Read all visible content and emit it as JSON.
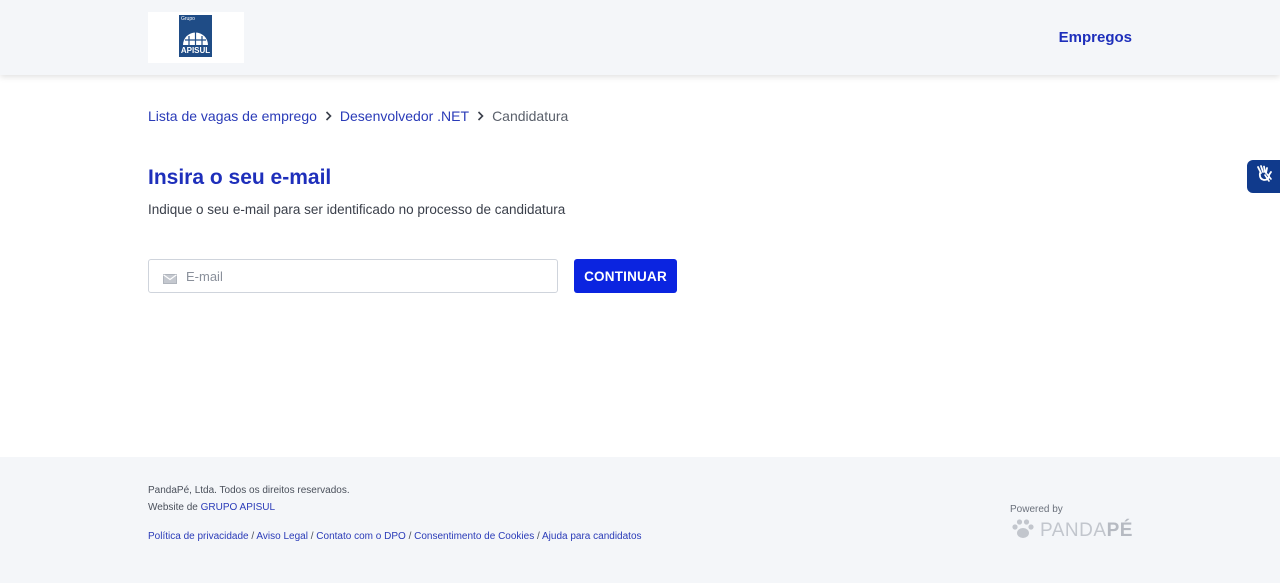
{
  "header": {
    "logo": {
      "small_text": "Grupo",
      "text": "APISUL"
    },
    "nav": {
      "empregos": "Empregos"
    }
  },
  "breadcrumb": {
    "items": [
      {
        "label": "Lista de vagas de emprego"
      },
      {
        "label": "Desenvolvedor .NET"
      }
    ],
    "current": "Candidatura"
  },
  "main": {
    "title": "Insira o seu e-mail",
    "subtitle": "Indique o seu e-mail para ser identificado no processo de candidatura",
    "email": {
      "value": "",
      "placeholder": "E-mail",
      "icon": "mail-icon"
    },
    "continue_label": "CONTINUAR"
  },
  "accessibility": {
    "icon": "sign-language-hands-icon"
  },
  "footer": {
    "copyright": "PandaPé, Ltda. Todos os direitos reservados.",
    "website_prefix": "Website de",
    "website_link": "GRUPO APISUL",
    "links": [
      {
        "label": "Política de privacidade"
      },
      {
        "label": "Aviso Legal"
      },
      {
        "label": "Contato com o DPO"
      },
      {
        "label": "Consentimento de Cookies"
      },
      {
        "label": "Ajuda para candidatos"
      }
    ],
    "powered_by": "Powered by",
    "brand_light": "PANDA",
    "brand_bold": "PÉ"
  },
  "colors": {
    "primary": "#1e2fbb",
    "button": "#0b24e0",
    "header_bg": "#f4f6f9",
    "accessibility_bg": "#103a8c"
  }
}
